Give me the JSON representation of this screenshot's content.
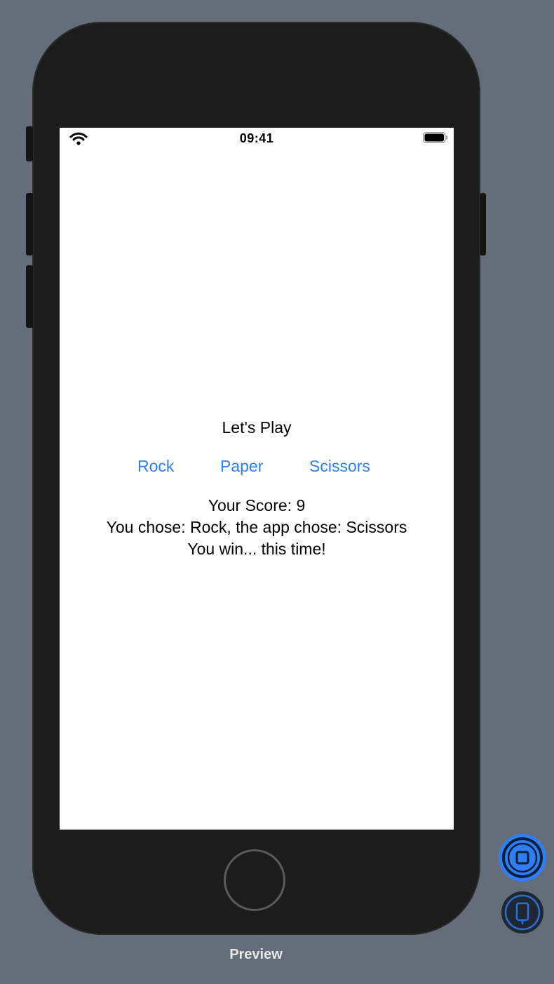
{
  "status_bar": {
    "time": "09:41",
    "wifi_icon": "wifi-icon",
    "battery_icon": "battery-icon"
  },
  "app": {
    "title": "Let's Play",
    "choices": [
      {
        "label": "Rock"
      },
      {
        "label": "Paper"
      },
      {
        "label": "Scissors"
      }
    ],
    "score_text": "Your Score: 9",
    "last_round_text": "You chose: Rock, the app chose: Scissors",
    "result_text": "You win... this time!"
  },
  "preview": {
    "label": "Preview",
    "live_button_icon": "live-preview-icon",
    "device_button_icon": "device-preview-icon"
  },
  "colors": {
    "accent": "#2f7ff3",
    "background": "#646d79",
    "phone_body": "#1c1c1d"
  }
}
